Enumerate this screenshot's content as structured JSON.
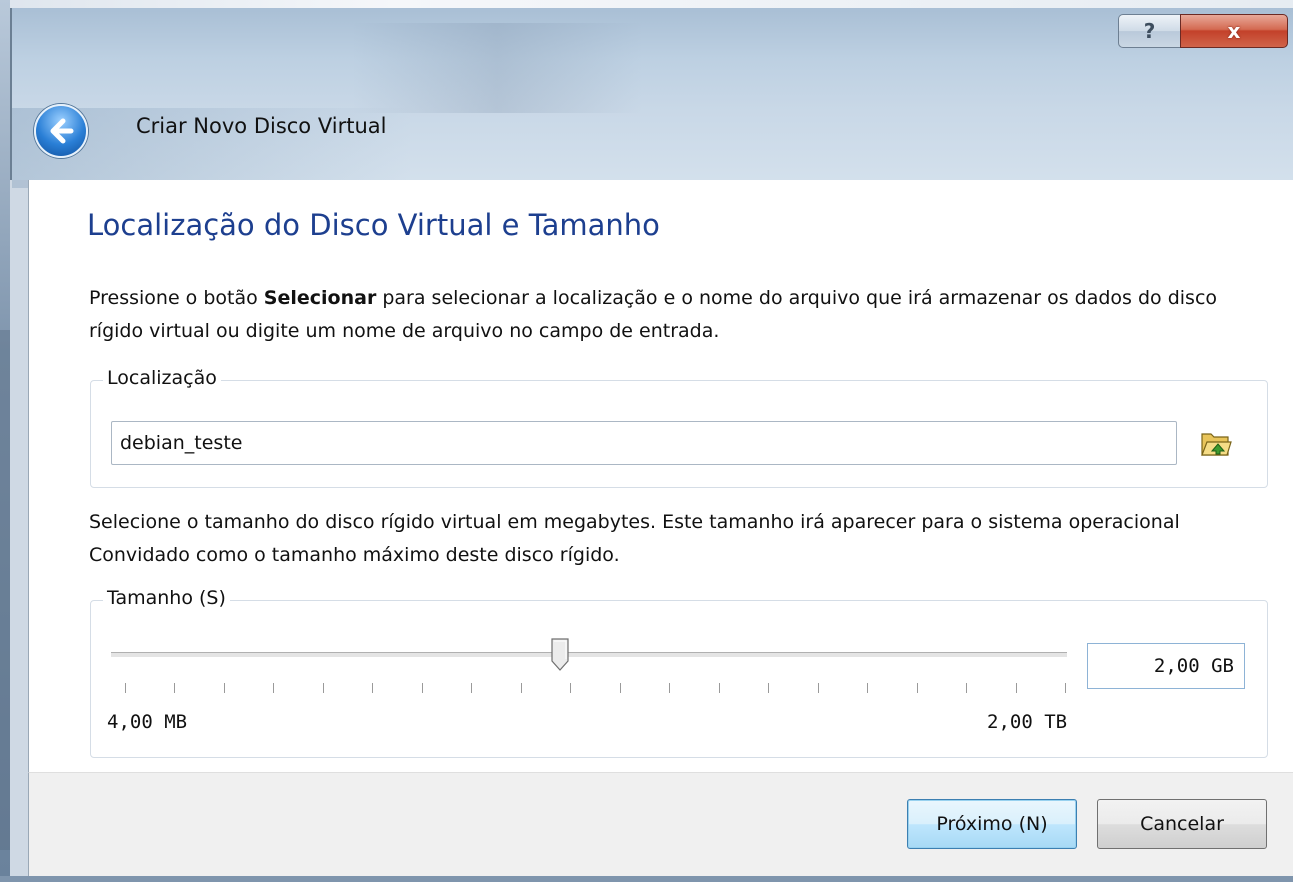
{
  "window": {
    "help_glyph": "?",
    "close_glyph": "x"
  },
  "wizard": {
    "title": "Criar Novo Disco Virtual"
  },
  "page": {
    "heading": "Localização do Disco Virtual e Tamanho",
    "intro_pre": "Pressione o botão ",
    "intro_bold": "Selecionar",
    "intro_post": " para selecionar a localização e o nome do arquivo que irá armazenar os dados do disco rígido virtual ou digite um nome de arquivo no campo de entrada.",
    "location_group_label": "Localização",
    "location_value": "debian_teste",
    "size_description": "Selecione o tamanho do disco rígido virtual em megabytes. Este tamanho irá aparecer para o sistema operacional Convidado como o tamanho máximo deste disco rígido.",
    "size_group_label": "Tamanho (S)",
    "size_value": "2,00 GB",
    "size_min_label": "4,00 MB",
    "size_max_label": "2,00 TB",
    "slider_position_fraction": 0.47,
    "tick_count": 20
  },
  "buttons": {
    "next_label": "Próximo (N)",
    "cancel_label": "Cancelar"
  },
  "icons": {
    "back": "back-arrow-icon",
    "folder": "folder-open-icon"
  }
}
